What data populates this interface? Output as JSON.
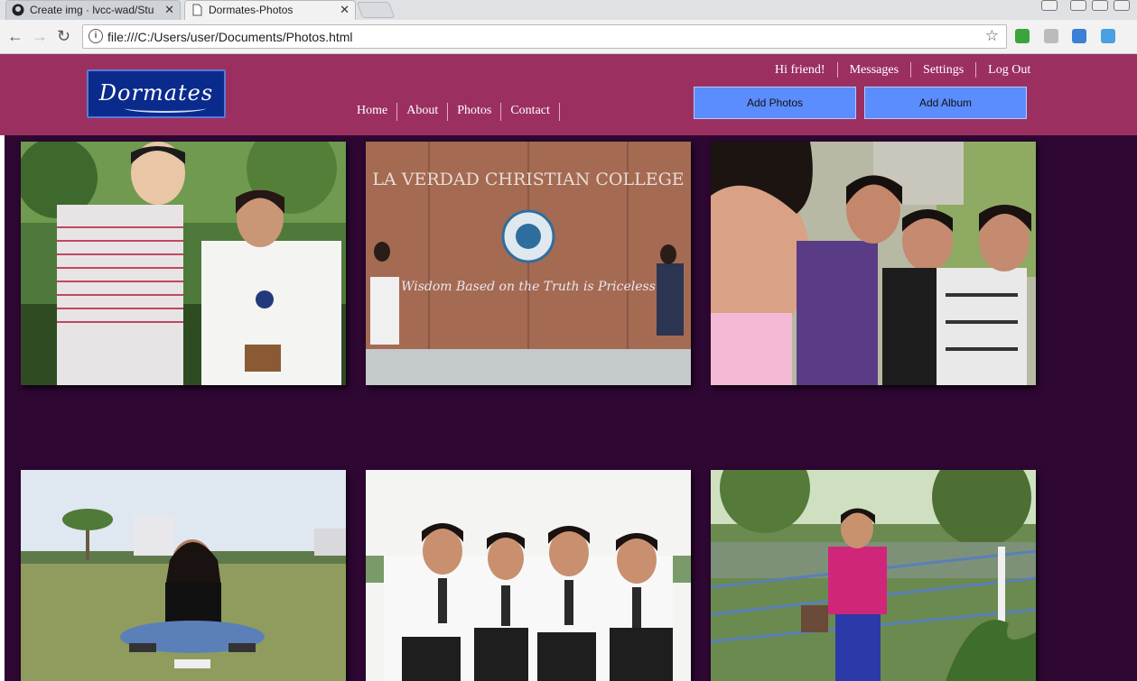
{
  "browser": {
    "tabs": [
      {
        "title": "Create img · lvcc-wad/Stu",
        "active": false
      },
      {
        "title": "Dormates-Photos",
        "active": true
      }
    ],
    "url": "file:///C:/Users/user/Documents/Photos.html"
  },
  "site": {
    "logo_text": "Dormates",
    "main_nav": [
      "Home",
      "About",
      "Photos",
      "Contact"
    ],
    "user_nav": [
      "Hi friend!",
      "Messages",
      "Settings",
      "Log Out"
    ],
    "add_photos_label": "Add Photos",
    "add_album_label": "Add Album",
    "colors": {
      "header": "#9b3060",
      "background": "#2e0733",
      "button": "#5c8dff"
    }
  },
  "photos": [
    {
      "kind": "photo",
      "description_icon": "photo-icon"
    },
    {
      "kind": "photo",
      "sign_text": "LA VERDAD CHRISTIAN COLLEGE",
      "motto_text": "Wisdom Based on the Truth is Priceless"
    },
    {
      "kind": "photo",
      "description_icon": "photo-icon"
    },
    {
      "kind": "photo",
      "description_icon": "photo-icon"
    },
    {
      "kind": "photo",
      "description_icon": "photo-icon"
    },
    {
      "kind": "photo",
      "description_icon": "photo-icon"
    }
  ]
}
